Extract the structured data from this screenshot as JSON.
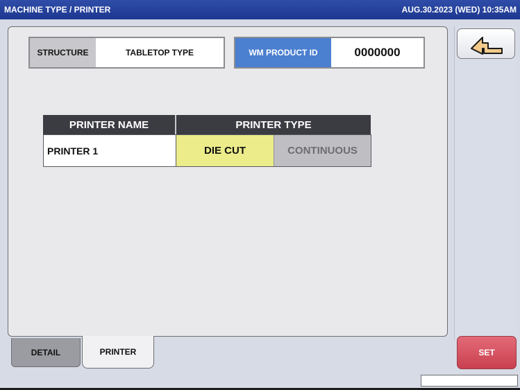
{
  "header": {
    "title": "MACHINE TYPE / PRINTER",
    "datetime": "AUG.30.2023 (WED)  10:35AM"
  },
  "structure": {
    "label": "STRUCTURE",
    "value": "TABLETOP TYPE"
  },
  "wm_product_id": {
    "label": "WM PRODUCT ID",
    "value": "0000000"
  },
  "printer_table": {
    "headers": [
      "PRINTER NAME",
      "PRINTER TYPE"
    ],
    "rows": [
      {
        "name": "PRINTER 1",
        "options": [
          "DIE CUT",
          "CONTINUOUS"
        ],
        "selected": "DIE CUT"
      }
    ]
  },
  "tabs": [
    {
      "label": "DETAIL",
      "active": false
    },
    {
      "label": "PRINTER",
      "active": true
    }
  ],
  "buttons": {
    "back_icon": "return-arrow-icon",
    "set_label": "SET"
  },
  "colors": {
    "title_bar": "#2f4da8",
    "accent_blue": "#4b7fd0",
    "selected_option": "#ecec8a",
    "set_button": "#d94f5e"
  }
}
